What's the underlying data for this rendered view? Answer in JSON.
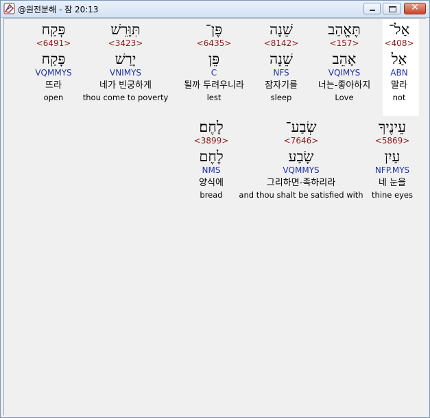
{
  "window": {
    "title": "@원전분해 - 잠 20:13",
    "buttons": {
      "minimize": "minimize",
      "maximize": "maximize",
      "close": "✕"
    }
  },
  "rows": [
    {
      "words": [
        {
          "hebrew": "אַל־",
          "strong": "<408>",
          "lemma": "אַל",
          "morph": "ABN",
          "korean": "말라",
          "english": "not",
          "selected": true
        },
        {
          "hebrew": "תֶּאֱהַב",
          "strong": "<157>",
          "lemma": "אָהֵב",
          "morph": "VQIMYS",
          "korean": "너는-좋아하지",
          "english": "Love"
        },
        {
          "hebrew": "שֵׁנָה",
          "strong": "<8142>",
          "lemma": "שֵׁנָה",
          "morph": "NFS",
          "korean": "잠자기를",
          "english": "sleep"
        },
        {
          "hebrew": "פֶּן־",
          "strong": "<6435>",
          "lemma": "פֵּן",
          "morph": "C",
          "korean": "될까 두려우니라",
          "english": "lest"
        },
        {
          "hebrew": "תִּוָּרֵשׁ",
          "strong": "<3423>",
          "lemma": "יָרַשׁ",
          "morph": "VNIMYS",
          "korean": "네가 빈궁하게",
          "english": "thou come to poverty"
        },
        {
          "hebrew": "פְּקַח",
          "strong": "<6491>",
          "lemma": "פָּקַח",
          "morph": "VQMMYS",
          "korean": "뜨라",
          "english": "open"
        }
      ]
    },
    {
      "words": [
        {
          "hebrew": "עֵינֶיךָ",
          "strong": "<5869>",
          "lemma": "עַיִן",
          "morph": "NFP.MYS",
          "korean": "네 눈을",
          "english": "thine eyes"
        },
        {
          "hebrew": "שְׂבַע־",
          "strong": "<7646>",
          "lemma": "שָׂבַע",
          "morph": "VQMMYS",
          "korean": "그리하면-족하리라",
          "english": "and thou shalt be satisfied with"
        },
        {
          "hebrew": "לָחֶם׃",
          "strong": "<3899>",
          "lemma": "לֶחֶם",
          "morph": "NMS",
          "korean": "양식에",
          "english": "bread"
        }
      ]
    }
  ]
}
